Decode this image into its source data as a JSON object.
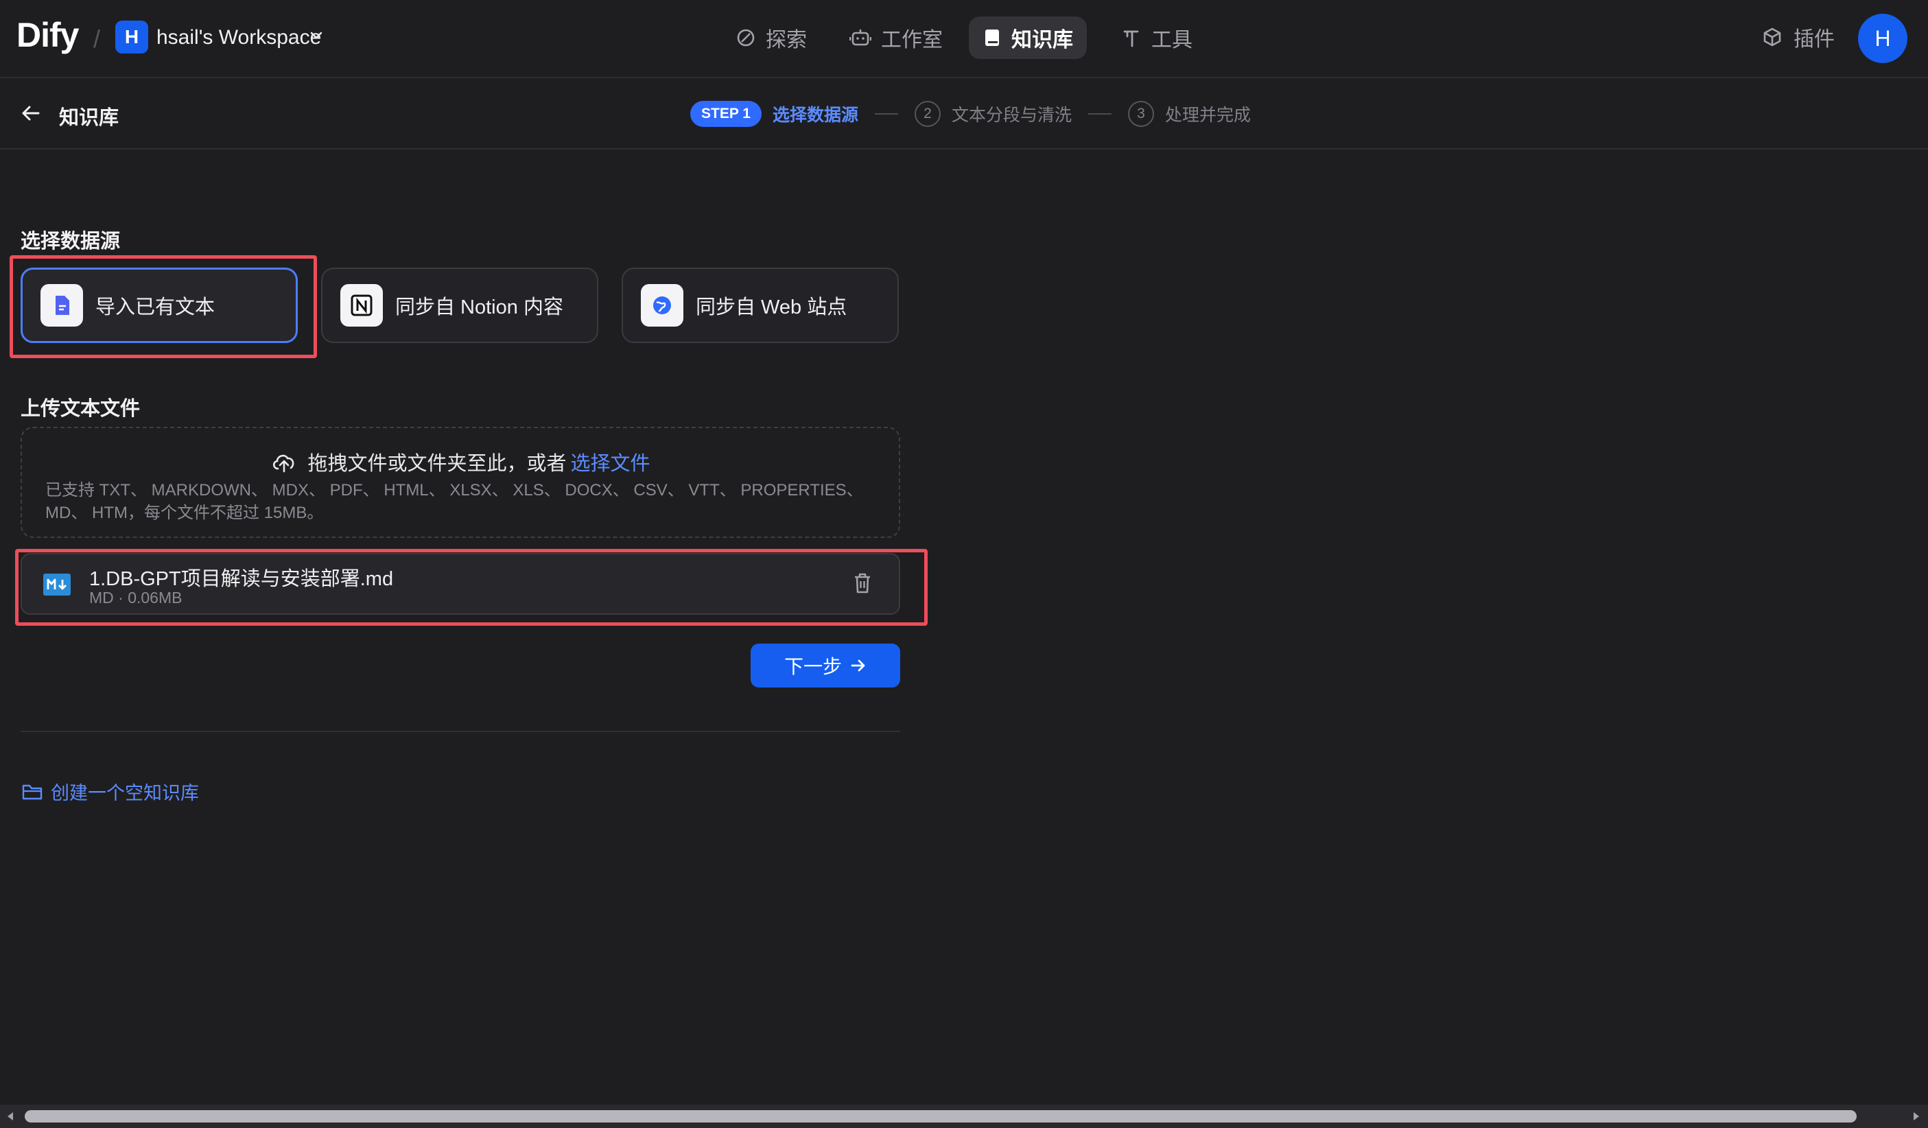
{
  "app": {
    "logo": "Dify",
    "separator": "/"
  },
  "workspace": {
    "badge": "H",
    "name": "hsail's Workspace"
  },
  "nav": [
    {
      "label": "探索",
      "icon": "compass-icon",
      "active": false
    },
    {
      "label": "工作室",
      "icon": "robot-icon",
      "active": false
    },
    {
      "label": "知识库",
      "icon": "book-icon",
      "active": true
    },
    {
      "label": "工具",
      "icon": "hammer-icon",
      "active": false
    }
  ],
  "plugin": {
    "label": "插件",
    "icon": "cube-icon"
  },
  "avatar": {
    "initial": "H"
  },
  "subheader": {
    "title": "知识库"
  },
  "steps": {
    "step1_pill": "STEP 1",
    "step1_label": "选择数据源",
    "step2_num": "2",
    "step2_label": "文本分段与清洗",
    "step3_num": "3",
    "step3_label": "处理并完成"
  },
  "source": {
    "title": "选择数据源",
    "cards": [
      {
        "label": "导入已有文本",
        "icon": "document-icon",
        "selected": true
      },
      {
        "label": "同步自 Notion 内容",
        "icon": "notion-icon",
        "selected": false
      },
      {
        "label": "同步自 Web 站点",
        "icon": "globe-icon",
        "selected": false
      }
    ]
  },
  "upload": {
    "title": "上传文本文件",
    "drop_text": "拖拽文件或文件夹至此，或者",
    "choose_link": "选择文件",
    "supported": "已支持 TXT、 MARKDOWN、 MDX、 PDF、 HTML、 XLSX、 XLS、 DOCX、 CSV、 VTT、 PROPERTIES、 MD、 HTM，每个文件不超过 15MB。"
  },
  "file": {
    "name": "1.DB-GPT项目解读与安装部署.md",
    "meta": "MD · 0.06MB"
  },
  "actions": {
    "next": "下一步",
    "create_empty": "创建一个空知识库"
  },
  "colors": {
    "accent": "#155eef",
    "link": "#5b8cff",
    "annotation": "#ee4d5a",
    "background": "#1e1e21"
  }
}
